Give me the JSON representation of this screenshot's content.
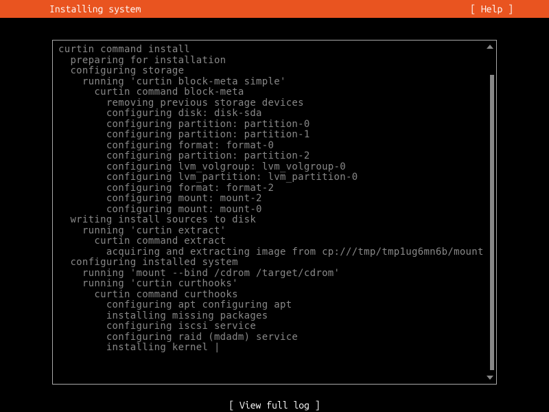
{
  "header": {
    "title": "Installing system",
    "help": "[ Help ]"
  },
  "log": {
    "lines": [
      {
        "indent": 0,
        "text": "curtin command install"
      },
      {
        "indent": 1,
        "text": "preparing for installation"
      },
      {
        "indent": 1,
        "text": "configuring storage"
      },
      {
        "indent": 2,
        "text": "running 'curtin block-meta simple'"
      },
      {
        "indent": 3,
        "text": "curtin command block-meta"
      },
      {
        "indent": 4,
        "text": "removing previous storage devices"
      },
      {
        "indent": 4,
        "text": "configuring disk: disk-sda"
      },
      {
        "indent": 4,
        "text": "configuring partition: partition-0"
      },
      {
        "indent": 4,
        "text": "configuring partition: partition-1"
      },
      {
        "indent": 4,
        "text": "configuring format: format-0"
      },
      {
        "indent": 4,
        "text": "configuring partition: partition-2"
      },
      {
        "indent": 4,
        "text": "configuring lvm_volgroup: lvm_volgroup-0"
      },
      {
        "indent": 4,
        "text": "configuring lvm_partition: lvm_partition-0"
      },
      {
        "indent": 4,
        "text": "configuring format: format-2"
      },
      {
        "indent": 4,
        "text": "configuring mount: mount-2"
      },
      {
        "indent": 4,
        "text": "configuring mount: mount-0"
      },
      {
        "indent": 1,
        "text": "writing install sources to disk"
      },
      {
        "indent": 2,
        "text": "running 'curtin extract'"
      },
      {
        "indent": 3,
        "text": "curtin command extract"
      },
      {
        "indent": 4,
        "text": "acquiring and extracting image from cp:///tmp/tmp1ug6mn6b/mount"
      },
      {
        "indent": 1,
        "text": "configuring installed system"
      },
      {
        "indent": 2,
        "text": "running 'mount --bind /cdrom /target/cdrom'"
      },
      {
        "indent": 2,
        "text": "running 'curtin curthooks'"
      },
      {
        "indent": 3,
        "text": "curtin command curthooks"
      },
      {
        "indent": 4,
        "text": "configuring apt configuring apt"
      },
      {
        "indent": 4,
        "text": "installing missing packages"
      },
      {
        "indent": 4,
        "text": "configuring iscsi service"
      },
      {
        "indent": 4,
        "text": "configuring raid (mdadm) service"
      },
      {
        "indent": 4,
        "text": "installing kernel |",
        "cursor": true
      }
    ]
  },
  "footer": {
    "view_log": "[ View full log ]"
  }
}
